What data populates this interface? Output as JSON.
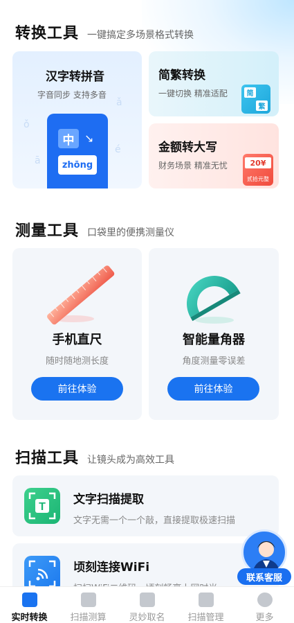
{
  "conversion": {
    "title": "转换工具",
    "subtitle": "一键搞定多场景格式转换",
    "pinyin": {
      "title": "汉字转拼音",
      "desc": "字音同步 支持多音",
      "char": "中",
      "py": "zhōng"
    },
    "fanjian": {
      "title": "简繁转换",
      "desc": "一键切换 精准适配",
      "badge_a": "简",
      "badge_b": "繁"
    },
    "money": {
      "title": "金额转大写",
      "desc": "财务场景 精准无忧",
      "amount": "20¥",
      "caps": "贰拾元整"
    }
  },
  "measure": {
    "title": "测量工具",
    "subtitle": "口袋里的便携测量仪",
    "cards": [
      {
        "title": "手机直尺",
        "desc": "随时随地测长度",
        "button": "前往体验"
      },
      {
        "title": "智能量角器",
        "desc": "角度测量零误差",
        "button": "前往体验"
      }
    ]
  },
  "scan": {
    "title": "扫描工具",
    "subtitle": "让镜头成为高效工具",
    "items": [
      {
        "title": "文字扫描提取",
        "desc": "文字无需一个一个敲，直接提取极速扫描"
      },
      {
        "title": "顷刻连接WiFi",
        "desc": "扫扫WiFi二维码，顷刻畅享上网时光"
      }
    ]
  },
  "service": {
    "label": "联系客服"
  },
  "nav": {
    "items": [
      {
        "label": "实时转换",
        "icon": "convert-icon"
      },
      {
        "label": "扫描测算",
        "icon": "scan-icon"
      },
      {
        "label": "灵妙取名",
        "icon": "pen-icon"
      },
      {
        "label": "扫描管理",
        "icon": "folder-icon"
      },
      {
        "label": "更多",
        "icon": "user-icon"
      }
    ]
  },
  "colors": {
    "accent": "#1a73f0",
    "green": "#1bb574",
    "red": "#f04a3c"
  }
}
